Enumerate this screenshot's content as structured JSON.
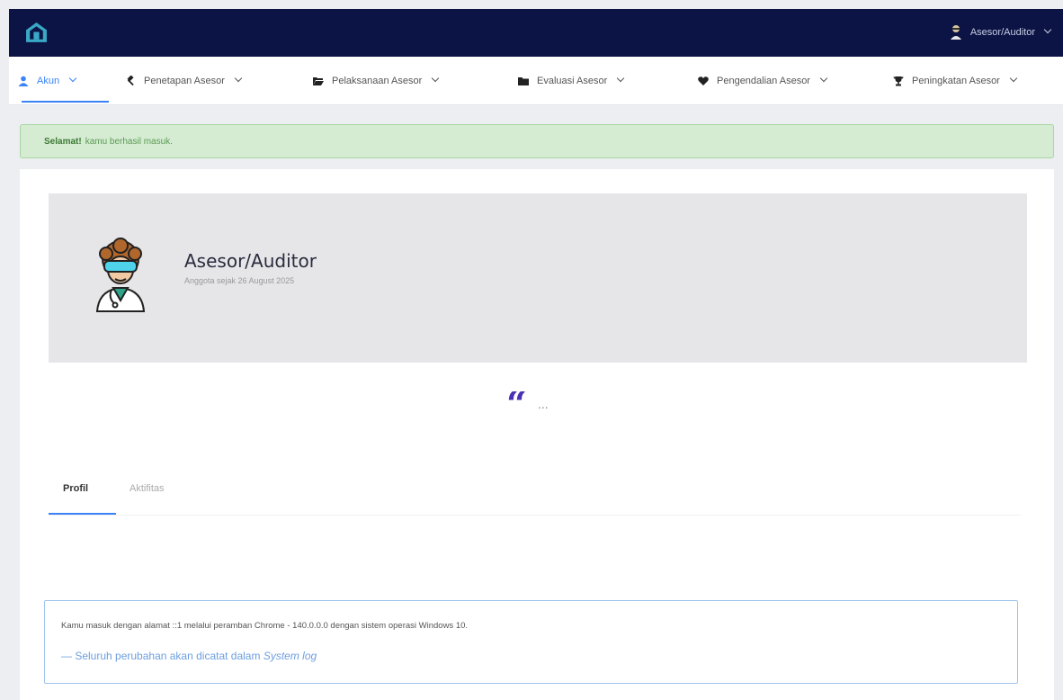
{
  "header": {
    "logo_icon": "home-icon",
    "user_label": "Asesor/Auditor"
  },
  "nav": {
    "items": [
      {
        "label": "Akun",
        "icon": "user-icon"
      },
      {
        "label": "Penetapan Asesor",
        "icon": "gavel-icon"
      },
      {
        "label": "Pelaksanaan Asesor",
        "icon": "folder-open-icon"
      },
      {
        "label": "Evaluasi Asesor",
        "icon": "folder-icon"
      },
      {
        "label": "Pengendalian Asesor",
        "icon": "heart-icon"
      },
      {
        "label": "Peningkatan Asesor",
        "icon": "trophy-icon"
      }
    ]
  },
  "alert": {
    "title": "Selamat!",
    "message": "kamu berhasil masuk."
  },
  "profile": {
    "name": "Asesor/Auditor",
    "member_since": "Anggota sejak 26 August 2025"
  },
  "quote": {
    "text": "..."
  },
  "tabs": [
    {
      "label": "Profil"
    },
    {
      "label": "Aktifitas"
    }
  ],
  "info": {
    "login_text": "Kamu masuk dengan alamat ::1 melalui peramban Chrome - 140.0.0.0 dengan sistem operasi Windows 10.",
    "log_prefix": "— Seluruh perubahan akan dicatat dalam ",
    "log_link": "System log"
  },
  "colors": {
    "topbar": "#0c1445",
    "accent": "#3b82f6",
    "quote": "#4b2fb4",
    "alert_bg": "#d5ecd2"
  }
}
